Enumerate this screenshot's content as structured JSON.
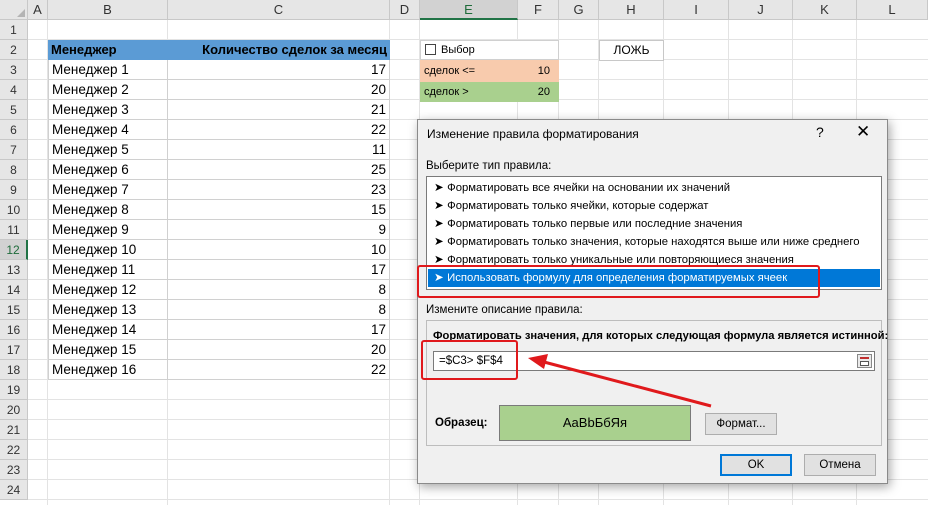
{
  "sheet": {
    "columns": [
      "A",
      "B",
      "C",
      "D",
      "E",
      "F",
      "G",
      "H",
      "I",
      "J",
      "K",
      "L"
    ],
    "selected_column": "E",
    "rows": [
      "1",
      "2",
      "3",
      "4",
      "5",
      "6",
      "7",
      "8",
      "9",
      "10",
      "11",
      "12",
      "13",
      "14",
      "15",
      "16",
      "17",
      "18",
      "19",
      "20",
      "21",
      "22",
      "23",
      "24"
    ],
    "selected_row": "12",
    "table": {
      "header_manager": "Менеджер",
      "header_deals": "Количество сделок за месяц",
      "rows": [
        {
          "name": "Менеджер 1",
          "value": "17"
        },
        {
          "name": "Менеджер 2",
          "value": "20"
        },
        {
          "name": "Менеджер 3",
          "value": "21"
        },
        {
          "name": "Менеджер 4",
          "value": "22"
        },
        {
          "name": "Менеджер 5",
          "value": "11"
        },
        {
          "name": "Менеджер 6",
          "value": "25"
        },
        {
          "name": "Менеджер 7",
          "value": "23"
        },
        {
          "name": "Менеджер 8",
          "value": "15"
        },
        {
          "name": "Менеджер 9",
          "value": "9"
        },
        {
          "name": "Менеджер 10",
          "value": "10"
        },
        {
          "name": "Менеджер 11",
          "value": "17"
        },
        {
          "name": "Менеджер 12",
          "value": "8"
        },
        {
          "name": "Менеджер 13",
          "value": "8"
        },
        {
          "name": "Менеджер 14",
          "value": "17"
        },
        {
          "name": "Менеджер 15",
          "value": "20"
        },
        {
          "name": "Менеджер 16",
          "value": "22"
        }
      ]
    },
    "controls": {
      "checkbox_label": "Выбор",
      "row1_label": "сделок <=",
      "row1_value": "10",
      "row2_label": "сделок >",
      "row2_value": "20",
      "bool_value": "ЛОЖЬ"
    }
  },
  "dialog": {
    "title": "Изменение правила форматирования",
    "help": "?",
    "close": "✕",
    "select_type_label": "Выберите тип правила:",
    "rule_types": [
      "Форматировать все ячейки на основании их значений",
      "Форматировать только ячейки, которые содержат",
      "Форматировать только первые или последние значения",
      "Форматировать только значения, которые находятся выше или ниже среднего",
      "Форматировать только уникальные или повторяющиеся значения",
      "Использовать формулу для определения форматируемых ячеек"
    ],
    "selected_rule_index": 5,
    "edit_description_label": "Измените описание правила:",
    "formula_caption": "Форматировать значения, для которых следующая формула является истинной:",
    "formula_value": "=$C3> $F$4",
    "preview_label": "Образец:",
    "preview_text": "AaBbБбЯя",
    "format_button": "Формат...",
    "ok_button": "OK",
    "cancel_button": "Отмена"
  },
  "colors": {
    "header_blue": "#5b9bd5",
    "orange_fill": "#f8cbad",
    "green_fill": "#a9d08e",
    "highlight_red": "#e0191c",
    "selection_blue": "#0078d7"
  }
}
